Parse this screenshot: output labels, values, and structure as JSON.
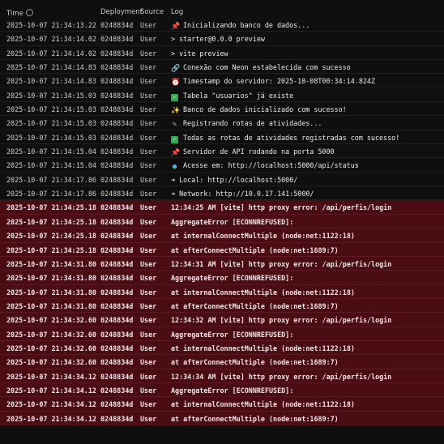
{
  "header": {
    "time": "Time",
    "deployment": "Deployment",
    "source": "Source",
    "log": "Log"
  },
  "rows": [
    {
      "time": "2025-10-07 21:34:13.22",
      "deployment": "0248834d",
      "source": "User",
      "icon": "pin-icon",
      "message": "Inicializando banco de dados...",
      "level": "info"
    },
    {
      "time": "2025-10-07 21:34:14.02",
      "deployment": "0248834d",
      "source": "User",
      "icon": "",
      "message": "> starter@0.0.0 preview",
      "level": "info"
    },
    {
      "time": "2025-10-07 21:34:14.02",
      "deployment": "0248834d",
      "source": "User",
      "icon": "",
      "message": "> vite preview",
      "level": "info"
    },
    {
      "time": "2025-10-07 21:34:14.83",
      "deployment": "0248834d",
      "source": "User",
      "icon": "link-icon",
      "message": "Conexão com Neon estabelecida com sucesso",
      "level": "info"
    },
    {
      "time": "2025-10-07 21:34:14.83",
      "deployment": "0248834d",
      "source": "User",
      "icon": "alarm-clock-icon",
      "message": "Timestamp do servidor: 2025-10-08T00:34:14.824Z",
      "level": "info"
    },
    {
      "time": "2025-10-07 21:34:15.03",
      "deployment": "0248834d",
      "source": "User",
      "icon": "check-icon",
      "message": "Tabela \"usuarios\" já existe",
      "level": "info"
    },
    {
      "time": "2025-10-07 21:34:15.03",
      "deployment": "0248834d",
      "source": "User",
      "icon": "sparkle-icon",
      "message": "Banco de dados inicializado com sucesso!",
      "level": "info"
    },
    {
      "time": "2025-10-07 21:34:15.03",
      "deployment": "0248834d",
      "source": "User",
      "icon": "pen-icon",
      "message": "Registrando rotas de atividades...",
      "level": "info"
    },
    {
      "time": "2025-10-07 21:34:15.03",
      "deployment": "0248834d",
      "source": "User",
      "icon": "check-icon",
      "message": "Todas as rotas de atividades registradas com sucesso!",
      "level": "info"
    },
    {
      "time": "2025-10-07 21:34:15.04",
      "deployment": "0248834d",
      "source": "User",
      "icon": "pin-icon",
      "message": "Servidor de API rodando na porta 5000",
      "level": "info"
    },
    {
      "time": "2025-10-07 21:34:15.04",
      "deployment": "0248834d",
      "source": "User",
      "icon": "globe-icon",
      "message": "Acesse em: http://localhost:5000/api/status",
      "level": "info"
    },
    {
      "time": "2025-10-07 21:34:17.86",
      "deployment": "0248834d",
      "source": "User",
      "icon": "",
      "message": "➜ Local: http://localhost:5000/",
      "level": "info"
    },
    {
      "time": "2025-10-07 21:34:17.86",
      "deployment": "0248834d",
      "source": "User",
      "icon": "",
      "message": "➜ Network: http://10.0.17.141:5000/",
      "level": "info"
    },
    {
      "time": "2025-10-07 21:34:25.18",
      "deployment": "0248834d",
      "source": "User",
      "icon": "",
      "message": "12:34:25 AM [vite] http proxy error: /api/perfis/login",
      "level": "error"
    },
    {
      "time": "2025-10-07 21:34:25.18",
      "deployment": "0248834d",
      "source": "User",
      "icon": "",
      "message": "AggregateError [ECONNREFUSED]:",
      "level": "error"
    },
    {
      "time": "2025-10-07 21:34:25.18",
      "deployment": "0248834d",
      "source": "User",
      "icon": "",
      "message": "at internalConnectMultiple (node:net:1122:18)",
      "level": "error"
    },
    {
      "time": "2025-10-07 21:34:25.18",
      "deployment": "0248834d",
      "source": "User",
      "icon": "",
      "message": "at afterConnectMultiple (node:net:1689:7)",
      "level": "error"
    },
    {
      "time": "2025-10-07 21:34:31.80",
      "deployment": "0248834d",
      "source": "User",
      "icon": "",
      "message": "12:34:31 AM [vite] http proxy error: /api/perfis/login",
      "level": "error"
    },
    {
      "time": "2025-10-07 21:34:31.80",
      "deployment": "0248834d",
      "source": "User",
      "icon": "",
      "message": "AggregateError [ECONNREFUSED]:",
      "level": "error"
    },
    {
      "time": "2025-10-07 21:34:31.80",
      "deployment": "0248834d",
      "source": "User",
      "icon": "",
      "message": "at internalConnectMultiple (node:net:1122:18)",
      "level": "error"
    },
    {
      "time": "2025-10-07 21:34:31.80",
      "deployment": "0248834d",
      "source": "User",
      "icon": "",
      "message": "at afterConnectMultiple (node:net:1689:7)",
      "level": "error"
    },
    {
      "time": "2025-10-07 21:34:32.60",
      "deployment": "0248834d",
      "source": "User",
      "icon": "",
      "message": "12:34:32 AM [vite] http proxy error: /api/perfis/login",
      "level": "error"
    },
    {
      "time": "2025-10-07 21:34:32.60",
      "deployment": "0248834d",
      "source": "User",
      "icon": "",
      "message": "AggregateError [ECONNREFUSED]:",
      "level": "error"
    },
    {
      "time": "2025-10-07 21:34:32.60",
      "deployment": "0248834d",
      "source": "User",
      "icon": "",
      "message": "at internalConnectMultiple (node:net:1122:18)",
      "level": "error"
    },
    {
      "time": "2025-10-07 21:34:32.60",
      "deployment": "0248834d",
      "source": "User",
      "icon": "",
      "message": "at afterConnectMultiple (node:net:1689:7)",
      "level": "error"
    },
    {
      "time": "2025-10-07 21:34:34.12",
      "deployment": "0248834d",
      "source": "User",
      "icon": "",
      "message": "12:34:34 AM [vite] http proxy error: /api/perfis/login",
      "level": "error"
    },
    {
      "time": "2025-10-07 21:34:34.12",
      "deployment": "0248834d",
      "source": "User",
      "icon": "",
      "message": "AggregateError [ECONNREFUSED]:",
      "level": "error"
    },
    {
      "time": "2025-10-07 21:34:34.12",
      "deployment": "0248834d",
      "source": "User",
      "icon": "",
      "message": "at internalConnectMultiple (node:net:1122:18)",
      "level": "error"
    },
    {
      "time": "2025-10-07 21:34:34.12",
      "deployment": "0248834d",
      "source": "User",
      "icon": "",
      "message": "at afterConnectMultiple (node:net:1689:7)",
      "level": "error"
    }
  ],
  "colors": {
    "background": "#0f0f10",
    "error_row": "#4a0d14",
    "text": "#e4e4e4"
  }
}
